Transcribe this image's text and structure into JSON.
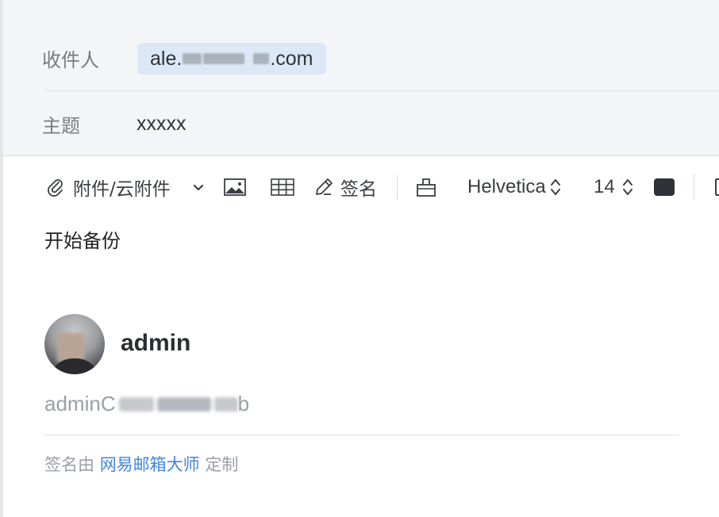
{
  "compose": {
    "to_label": "收件人",
    "to_value_prefix": "ale.",
    "to_value_suffix": ".com",
    "subject_label": "主题",
    "subject_value": "xxxxx"
  },
  "toolbar": {
    "attachment_label": "附件/云附件",
    "signature_label": "签名",
    "font_family": "Helvetica",
    "font_size": "14",
    "text_color": "#2f3338"
  },
  "body": {
    "text": "开始备份"
  },
  "signature": {
    "name": "admin",
    "email_prefix": "adminC",
    "email_suffix": "b",
    "footer_prefix": "签名由",
    "footer_link": "网易邮箱大师",
    "footer_suffix": "定制"
  },
  "colors": {
    "header_bg": "#f4f5f7",
    "chip_bg": "#dde8f7",
    "link": "#3f86e0"
  }
}
